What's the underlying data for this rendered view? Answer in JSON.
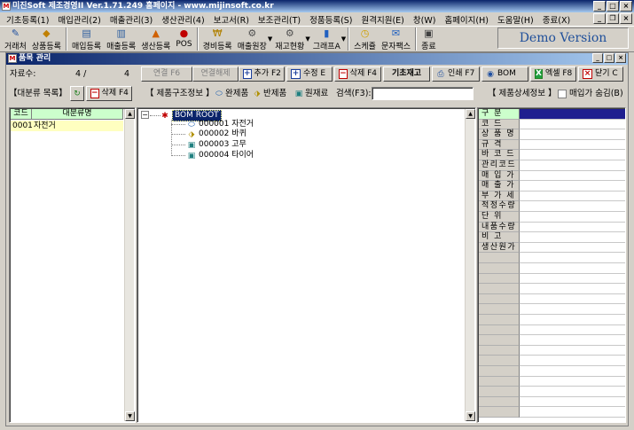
{
  "window": {
    "title": "미진Soft 제조경영II Ver.1.71.249          홈페이지 - www.mijinsoft.co.kr",
    "app_icon": "mijin-app-icon",
    "controls": [
      "_",
      "□",
      "×"
    ]
  },
  "menu": {
    "items": [
      "기초등록(1)",
      "매입관리(2)",
      "매출관리(3)",
      "생산관리(4)",
      "보고서(R)",
      "보조관리(T)",
      "정품등록(S)",
      "원격지원(E)",
      "창(W)",
      "홈페이지(H)",
      "도움말(H)",
      "종료(X)"
    ],
    "mdi_controls": [
      "_",
      "❐",
      "×"
    ]
  },
  "toolbar": {
    "buttons": [
      {
        "label": "거래처",
        "icon": "notepad-icon"
      },
      {
        "label": "상품등록",
        "icon": "cube-icon"
      },
      {
        "label": "매입등록",
        "icon": "document-in-icon"
      },
      {
        "label": "매출등록",
        "icon": "document-out-icon"
      },
      {
        "label": "생산등록",
        "icon": "factory-icon"
      },
      {
        "label": "POS",
        "icon": "pos-icon"
      },
      {
        "label": "경비등록",
        "icon": "money-icon"
      },
      {
        "label": "매출원장",
        "icon": "ledger-icon"
      },
      {
        "label": "재고현황",
        "icon": "stock-icon"
      },
      {
        "label": "그래프A",
        "icon": "chart-icon"
      },
      {
        "label": "스케쥴",
        "icon": "clock-icon"
      },
      {
        "label": "문자팩스",
        "icon": "fax-icon"
      },
      {
        "label": "종료",
        "icon": "exit-icon"
      }
    ],
    "demo_label": "Demo Version"
  },
  "child": {
    "title": "품목 관리",
    "record_label": "자료수:",
    "record_current": "4 /",
    "record_total": "4",
    "actions": {
      "link": "연결 F6",
      "unlink": "연결해제",
      "add": "추가 F2",
      "edit": "수정 E",
      "delete": "삭제 F4",
      "stock": "기초재고",
      "print": "인쇄 F7",
      "bom": "BOM",
      "excel": "엑셀 F8",
      "close": "닫기 C"
    },
    "row2": {
      "category_list": "【대분류 목록】",
      "delete": "삭제 F4",
      "structure_info": "【 제품구조정보 】",
      "finished": "완제품",
      "semi": "반제품",
      "raw": "원재료",
      "search_label": "검색(F3):",
      "search_value": "",
      "detail_info": "【 제품상세정보 】",
      "hide_purchase": "매입가 숨김(B)"
    },
    "category_grid": {
      "columns": [
        "코드",
        "대분류명"
      ],
      "rows": [
        {
          "code": "0001",
          "name": "자전거"
        }
      ]
    },
    "tree": {
      "root": "BOM ROOT",
      "nodes": [
        {
          "label": "000001 자전거",
          "icon": "finished-product-icon"
        },
        {
          "label": "000002 바퀴",
          "icon": "semi-product-icon"
        },
        {
          "label": "000003 고무",
          "icon": "raw-material-icon"
        },
        {
          "label": "000004 타이어",
          "icon": "raw-material-icon"
        }
      ]
    },
    "detail_grid": {
      "rows": [
        "구 분",
        "코 드",
        "상 품 명",
        "규 격",
        "바 코 드",
        "관리코드",
        "매 입 가",
        "매 출 가",
        "부 가 세",
        "적정수량",
        "단 위",
        "내품수량",
        "비 고",
        "생산원가"
      ]
    }
  }
}
